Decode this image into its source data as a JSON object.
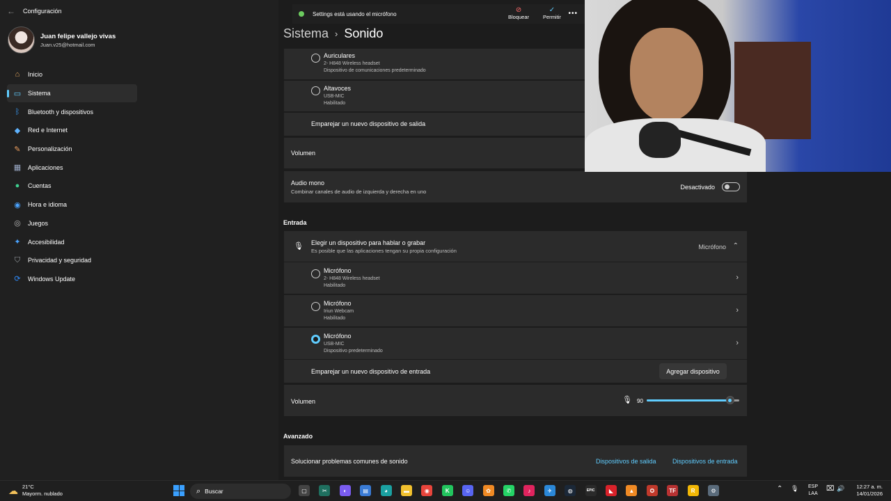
{
  "window": {
    "app_title": "Configuración",
    "back_glyph": "←"
  },
  "profile": {
    "name": "Juan felipe vallejo vivas",
    "email": "Juan.v25@hotmail.com"
  },
  "nav": {
    "items": [
      {
        "label": "Inicio",
        "icon": "home-icon",
        "glyph": "⌂",
        "color": "#e8a960"
      },
      {
        "label": "Sistema",
        "icon": "monitor-icon",
        "glyph": "▭",
        "color": "#60cdff"
      },
      {
        "label": "Bluetooth y dispositivos",
        "icon": "bluetooth-icon",
        "glyph": "ᛒ",
        "color": "#3aa0ff"
      },
      {
        "label": "Red e Internet",
        "icon": "wifi-icon",
        "glyph": "◆",
        "color": "#5fb3ff"
      },
      {
        "label": "Personalización",
        "icon": "brush-icon",
        "glyph": "✎",
        "color": "#f0a060"
      },
      {
        "label": "Aplicaciones",
        "icon": "apps-icon",
        "glyph": "▦",
        "color": "#9aa9c5"
      },
      {
        "label": "Cuentas",
        "icon": "person-icon",
        "glyph": "●",
        "color": "#3ecf8e"
      },
      {
        "label": "Hora e idioma",
        "icon": "globe-clock-icon",
        "glyph": "◉",
        "color": "#4aa3ff"
      },
      {
        "label": "Juegos",
        "icon": "gamepad-icon",
        "glyph": "◎",
        "color": "#b9b9b9"
      },
      {
        "label": "Accesibilidad",
        "icon": "accessibility-icon",
        "glyph": "✦",
        "color": "#4aa3ff"
      },
      {
        "label": "Privacidad y seguridad",
        "icon": "shield-icon",
        "glyph": "⛉",
        "color": "#9aa0a6"
      },
      {
        "label": "Windows Update",
        "icon": "update-icon",
        "glyph": "⟳",
        "color": "#2f8cff"
      }
    ]
  },
  "banner": {
    "text": "Settings está usando el micrófono",
    "block_label": "Bloquear",
    "allow_label": "Permitir",
    "more_glyph": "•••",
    "block_glyph": "⊘",
    "allow_glyph": "✓"
  },
  "breadcrumb": {
    "parent": "Sistema",
    "separator": "›",
    "current": "Sonido"
  },
  "output_devices": [
    {
      "name": "Auriculares",
      "model": "2- H848 Wireless headset",
      "status": "Dispositivo de comunicaciones predeterminado",
      "selected": false
    },
    {
      "name": "Altavoces",
      "model": "USB-MIC",
      "status": "Habilitado",
      "selected": false
    }
  ],
  "pair_output": {
    "label": "Emparejar un nuevo dispositivo de salida"
  },
  "output_volume": {
    "label": "Volumen"
  },
  "mono": {
    "title": "Audio mono",
    "subtitle": "Combinar canales de audio de izquierda y derecha en uno",
    "state_label": "Desactivado"
  },
  "input": {
    "section_title": "Entrada",
    "choose_title": "Elegir un dispositivo para hablar o grabar",
    "choose_subtitle": "Es posible que las aplicaciones tengan su propia configuración",
    "selected_value": "Micrófono",
    "devices": [
      {
        "name": "Micrófono",
        "model": "2- H848 Wireless headset",
        "status": "Habilitado",
        "selected": false
      },
      {
        "name": "Micrófono",
        "model": "Iriun Webcam",
        "status": "Habilitado",
        "selected": false
      },
      {
        "name": "Micrófono",
        "model": "USB-MIC",
        "status": "Dispositivo predeterminado",
        "selected": true
      }
    ],
    "pair_label": "Emparejar un nuevo dispositivo de entrada",
    "add_button": "Agregar dispositivo",
    "volume_label": "Volumen",
    "volume_value": "90",
    "volume_level": 0.9
  },
  "advanced": {
    "section_title": "Avanzado",
    "troubleshoot_label": "Solucionar problemas comunes de sonido",
    "output_link": "Dispositivos de salida",
    "input_link": "Dispositivos de entrada"
  },
  "taskbar": {
    "weather_temp": "21°C",
    "weather_desc": "Mayorm. nublado",
    "search_placeholder": "Buscar",
    "apps": [
      {
        "name": "task-view-icon",
        "glyph": "▢",
        "color": "#444444"
      },
      {
        "name": "snipping-icon",
        "glyph": "✂",
        "color": "#1f6f5f"
      },
      {
        "name": "copilot-icon",
        "glyph": "◐",
        "color": "#7a5cf0"
      },
      {
        "name": "store-icon",
        "glyph": "▤",
        "color": "#3a7bd5"
      },
      {
        "name": "edge-icon",
        "glyph": "◕",
        "color": "#1ba1a1"
      },
      {
        "name": "file-explorer-icon",
        "glyph": "▬",
        "color": "#f2c12e"
      },
      {
        "name": "chrome-icon",
        "glyph": "◉",
        "color": "#e8453c"
      },
      {
        "name": "kick-icon",
        "glyph": "K",
        "color": "#22c55e"
      },
      {
        "name": "discord-icon",
        "glyph": "☺",
        "color": "#5865f2"
      },
      {
        "name": "fl-studio-icon",
        "glyph": "✿",
        "color": "#f08a24"
      },
      {
        "name": "whatsapp-icon",
        "glyph": "✆",
        "color": "#25d366"
      },
      {
        "name": "tiktok-icon",
        "glyph": "♪",
        "color": "#e0245e"
      },
      {
        "name": "teams-icon",
        "glyph": "✈",
        "color": "#2b88d8"
      },
      {
        "name": "steam-icon",
        "glyph": "◍",
        "color": "#1b2838"
      },
      {
        "name": "epic-games-icon",
        "glyph": "EPIC",
        "color": "#2a2a2a"
      },
      {
        "name": "amd-icon",
        "glyph": "◣",
        "color": "#d9222a"
      },
      {
        "name": "vlc-icon",
        "glyph": "▲",
        "color": "#f08a24"
      },
      {
        "name": "app-badge-icon",
        "glyph": "✪",
        "color": "#c0392b"
      },
      {
        "name": "tf-icon",
        "glyph": "TF",
        "color": "#b83232"
      },
      {
        "name": "rockstar-icon",
        "glyph": "R",
        "color": "#f2b705"
      },
      {
        "name": "settings-icon",
        "glyph": "⚙",
        "color": "#5a6b7b"
      }
    ],
    "tray_chevron": "⌃",
    "tray_mic": "🎙",
    "lang_top": "ESP",
    "lang_bottom": "LAA",
    "tray_network": "⌧",
    "tray_volume": "🔊",
    "time": "12:27 a. m.",
    "date": "14/01/2026"
  }
}
